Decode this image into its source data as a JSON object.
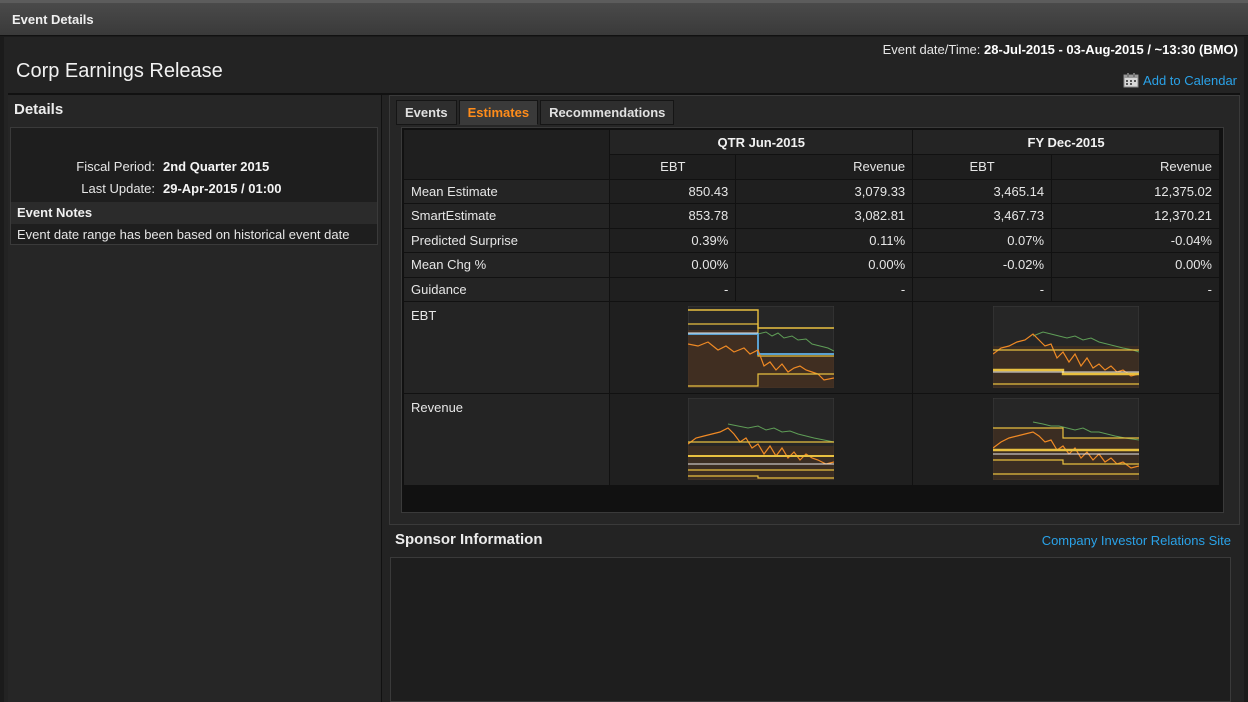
{
  "window": {
    "title": "Event Details"
  },
  "header": {
    "event_date_label": "Event date/Time:",
    "event_date_value": "28-Jul-2015 - 03-Aug-2015 / ~13:30 (BMO)",
    "page_title": "Corp Earnings Release",
    "add_to_calendar": "Add to Calendar"
  },
  "details": {
    "heading": "Details",
    "fiscal_period_label": "Fiscal Period:",
    "fiscal_period_value": "2nd Quarter 2015",
    "last_update_label": "Last Update:",
    "last_update_value": "29-Apr-2015 / 01:00",
    "notes_heading": "Event Notes",
    "notes_text": "Event date range has been based on historical event date"
  },
  "tabs": [
    {
      "label": "Events"
    },
    {
      "label": "Estimates",
      "active": true
    },
    {
      "label": "Recommendations"
    }
  ],
  "estimates": {
    "period_headers": [
      "QTR Jun-2015",
      "FY Dec-2015"
    ],
    "sub_headers": [
      "EBT",
      "Revenue",
      "EBT",
      "Revenue"
    ],
    "rows": [
      {
        "label": "Mean Estimate",
        "values": [
          "850.43",
          "3,079.33",
          "3,465.14",
          "12,375.02"
        ]
      },
      {
        "label": "SmartEstimate",
        "values": [
          "853.78",
          "3,082.81",
          "3,467.73",
          "12,370.21"
        ]
      },
      {
        "label": "Predicted Surprise",
        "values": [
          "0.39%",
          "0.11%",
          "0.07%",
          "-0.04%"
        ]
      },
      {
        "label": "Mean Chg %",
        "values": [
          "0.00%",
          "0.00%",
          "-0.02%",
          "0.00%"
        ]
      },
      {
        "label": "Guidance",
        "values": [
          "-",
          "-",
          "-",
          "-"
        ]
      }
    ],
    "chart_rows": [
      {
        "label": "EBT"
      },
      {
        "label": "Revenue"
      }
    ]
  },
  "sponsor": {
    "heading": "Sponsor Information",
    "ir_link": "Company Investor Relations Site"
  },
  "colors": {
    "accent_link": "#2aa2e8",
    "active_tab": "#ff8c1a",
    "spark_orange": "#f08a24",
    "spark_yellow": "#e8c040",
    "spark_green": "#5f9e57",
    "spark_blue": "#5aa0d0"
  }
}
